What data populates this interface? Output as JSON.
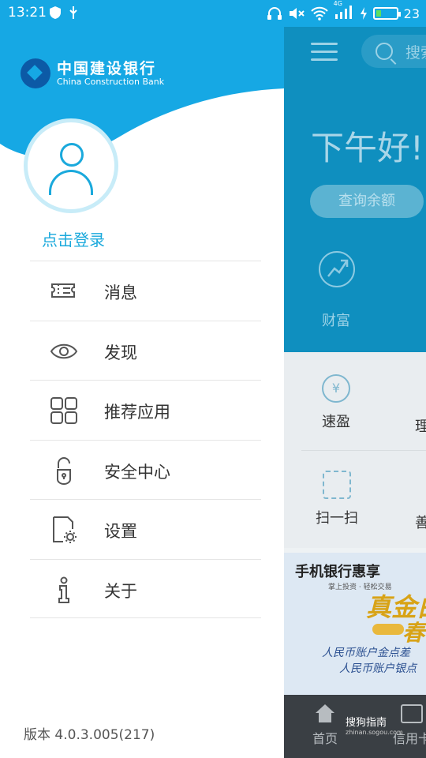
{
  "status_bar": {
    "time": "13:21",
    "network": "4G",
    "battery": "23",
    "battery_level": 0.23
  },
  "drawer": {
    "logo_cn": "中国建设银行",
    "logo_en": "China Construction Bank",
    "login_text": "点击登录",
    "menu": [
      {
        "label": "消息",
        "icon": "message-ticket-icon"
      },
      {
        "label": "发现",
        "icon": "eye-icon"
      },
      {
        "label": "推荐应用",
        "icon": "apps-grid-icon"
      },
      {
        "label": "安全中心",
        "icon": "lock-icon"
      },
      {
        "label": "设置",
        "icon": "settings-gear-icon"
      },
      {
        "label": "关于",
        "icon": "info-icon"
      }
    ],
    "version": "版本 4.0.3.005(217)"
  },
  "main": {
    "search_placeholder": "搜索",
    "greeting": "下午好!",
    "balance_button": "查询余额",
    "wealth_label": "财富",
    "quick_items": [
      {
        "label": "速盈",
        "icon": "yen-icon"
      },
      {
        "label": "理",
        "icon": ""
      },
      {
        "label": "扫一扫",
        "icon": "scan-icon"
      },
      {
        "label": "善",
        "icon": ""
      }
    ],
    "banner": {
      "title": "手机银行惠享",
      "subtitle": "掌上投资 · 轻松交易",
      "headline": "真金白",
      "headline2": "春",
      "line1": "人民币账户金点差",
      "line2": "人民币账户银点"
    },
    "tabs": [
      {
        "label": "首页",
        "icon": "home-icon"
      },
      {
        "label": "信用卡",
        "icon": "card-icon"
      }
    ],
    "watermark": "搜狗指南",
    "watermark_url": "zhinan.sogou.com"
  },
  "colors": {
    "brand_blue": "#16a8e4",
    "accent_text": "#1aa9dc",
    "main_dim_blue": "#0f8fbf"
  }
}
